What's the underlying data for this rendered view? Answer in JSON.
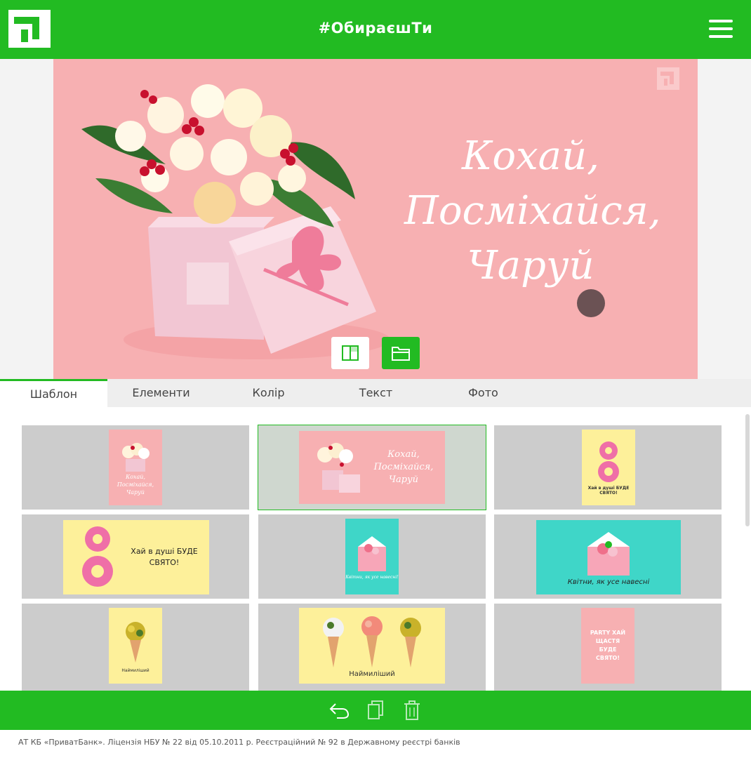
{
  "header": {
    "title": "#ОбираєшТи",
    "logo_icon": "privatbank-logo-icon",
    "menu_icon": "hamburger-menu-icon"
  },
  "card": {
    "background": "#f7b0b2",
    "lines": [
      "Кохай,",
      "Посміхайся,",
      "Чаруй"
    ],
    "watermark_icon": "privatbank-logo-icon",
    "tools": [
      {
        "name": "flip-layout-button",
        "icon": "layout-split-icon"
      },
      {
        "name": "open-folder-button",
        "icon": "folder-icon"
      }
    ]
  },
  "tabs": [
    {
      "label": "Шаблон",
      "active": true
    },
    {
      "label": "Елементи",
      "active": false
    },
    {
      "label": "Колір",
      "active": false
    },
    {
      "label": "Текст",
      "active": false
    },
    {
      "label": "Фото",
      "active": false
    }
  ],
  "templates": [
    {
      "id": "t1",
      "bg": "#f7b0b2",
      "orientation": "portrait",
      "text": "Кохай, Посміхайся, Чаруй"
    },
    {
      "id": "t2",
      "bg": "#f7b0b2",
      "orientation": "landscape",
      "text": "Кохай, Посміхайся, Чаруй",
      "selected": true
    },
    {
      "id": "t3",
      "bg": "#fdf09a",
      "orientation": "portrait",
      "text": "Хай в душі БУДЕ СВЯТО!"
    },
    {
      "id": "t4",
      "bg": "#fdf09a",
      "orientation": "landscape",
      "text": "Хай в душі БУДЕ СВЯТО!"
    },
    {
      "id": "t5",
      "bg": "#3fd6c8",
      "orientation": "portrait",
      "text": "Квітни, як усе навесні!"
    },
    {
      "id": "t6",
      "bg": "#3fd6c8",
      "orientation": "landscape",
      "text": "Квітни, як усе навесні"
    },
    {
      "id": "t7",
      "bg": "#fdf09a",
      "orientation": "portrait",
      "text": "Наймиліший"
    },
    {
      "id": "t8",
      "bg": "#fdf09a",
      "orientation": "landscape",
      "text": "Наймиліший"
    },
    {
      "id": "t9",
      "bg": "#f7b0b2",
      "orientation": "portrait",
      "text": "PARTY ХАЙ ЩАСТЯ БУДЕ СВЯТО!"
    }
  ],
  "bottom_bar": {
    "undo_icon": "undo-icon",
    "copy_icon": "copy-icon",
    "delete_icon": "trash-icon"
  },
  "footer": {
    "text": "АТ КБ «ПриватБанк». Ліцензія НБУ № 22 від 05.10.2011 р. Реєстраційний № 92 в Державному реєстрі банків"
  }
}
